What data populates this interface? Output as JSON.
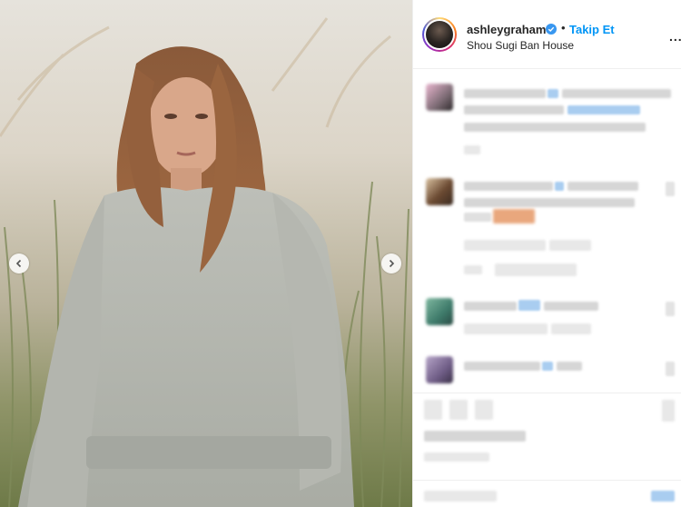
{
  "post": {
    "username": "ashleygraham",
    "follow_label": "Takip Et",
    "separator": "•",
    "location": "Shou Sugi Ban House",
    "more_label": "..."
  },
  "icons": {
    "verified": "verified-badge-icon",
    "prev": "chevron-left-icon",
    "next": "chevron-right-icon"
  },
  "colors": {
    "accent": "#0095f6",
    "text": "#262626",
    "divider": "#efefef"
  }
}
